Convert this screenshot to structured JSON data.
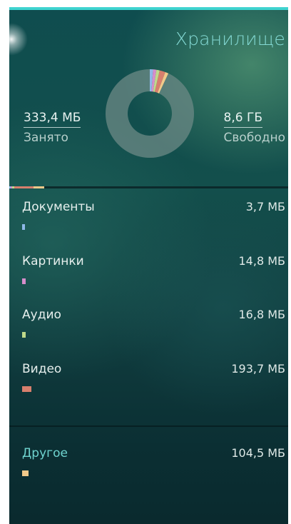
{
  "header": {
    "title": "Хранилище"
  },
  "summary": {
    "used_value": "333,4 МБ",
    "used_label": "Занято",
    "free_value": "8,6 ГБ",
    "free_label": "Свободно"
  },
  "chart_data": {
    "type": "pie",
    "slices": [
      {
        "category": "Документы",
        "value_mb": 3.7,
        "color": "#8fb8e8"
      },
      {
        "category": "Картинки",
        "value_mb": 14.8,
        "color": "#d68ecb"
      },
      {
        "category": "Аудио",
        "value_mb": 16.8,
        "color": "#bfd98a"
      },
      {
        "category": "Видео",
        "value_mb": 193.7,
        "color": "#d77f6d"
      },
      {
        "category": "Другое",
        "value_mb": 104.5,
        "color": "#f0c98a"
      },
      {
        "category": "Свободно",
        "value_mb": 8806.4,
        "color": "#6c8a86"
      }
    ]
  },
  "categories": [
    {
      "name": "Документы",
      "size": "3,7 МБ",
      "color": "#8fb8e8"
    },
    {
      "name": "Картинки",
      "size": "14,8 МБ",
      "color": "#d68ecb"
    },
    {
      "name": "Аудио",
      "size": "16,8 МБ",
      "color": "#bfd98a"
    },
    {
      "name": "Видео",
      "size": "193,7 МБ",
      "color": "#d77f6d"
    }
  ],
  "other": {
    "name": "Другое",
    "size": "104,5 МБ",
    "color": "#f0c98a"
  }
}
